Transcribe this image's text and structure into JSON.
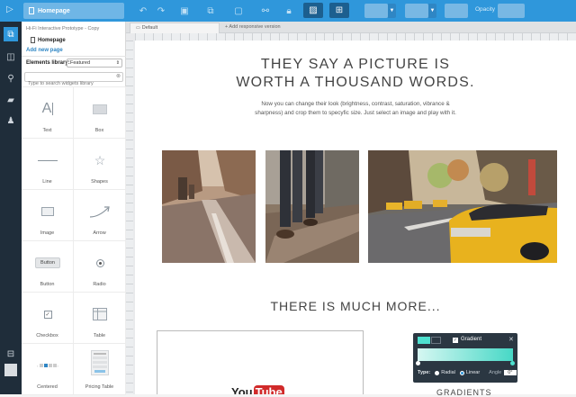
{
  "toolbar": {
    "page_name": "Homepage",
    "opacity_label": "Opacity",
    "accent": "#2f97db"
  },
  "left_icons": [
    "run-icon",
    "pages-icon",
    "layers-icon",
    "search-icon",
    "comments-icon",
    "users-icon",
    "export-icon",
    "avatar"
  ],
  "panel": {
    "project_name": "Hi-Fi Interactive Prototype - Copy",
    "page_item": "Homepage",
    "add_page": "Add new page",
    "library_label": "Elements library:",
    "library_value": "Featured",
    "search_placeholder": "Type to search widgets library",
    "widgets": [
      {
        "label": "Text",
        "icon": "text-icon"
      },
      {
        "label": "Box",
        "icon": "box-icon"
      },
      {
        "label": "Line",
        "icon": "line-icon"
      },
      {
        "label": "Shapes",
        "icon": "star-icon"
      },
      {
        "label": "Image",
        "icon": "image-icon"
      },
      {
        "label": "Arrow",
        "icon": "arrow-icon"
      },
      {
        "label": "Button",
        "icon": "button-icon",
        "icon_text": "Button"
      },
      {
        "label": "Radio",
        "icon": "radio-icon"
      },
      {
        "label": "Checkbox",
        "icon": "checkbox-icon"
      },
      {
        "label": "Table",
        "icon": "table-icon"
      },
      {
        "label": "Centered",
        "icon": "pagination-icon"
      },
      {
        "label": "Pricing Table",
        "icon": "pricing-table-icon"
      }
    ]
  },
  "canvas": {
    "tab_default": "Default",
    "tab_add": "+ Add responsive version",
    "headline_line1": "THEY SAY A PICTURE IS",
    "headline_line2": "WORTH A THOUSAND WORDS.",
    "body_line1": "Now you can change their look (brightness, contrast, saturation, vibrance &",
    "body_line2": "sharpness) and crop them to specyfic size. Just select an image and play with it.",
    "section2": "THERE IS MUCH MORE...",
    "youtube_you": "You",
    "youtube_tube": "Tube"
  },
  "gradient_popup": {
    "title": "Gradient",
    "type_label": "Type:",
    "radial": "Radial",
    "linear": "Linear",
    "angle": "Angle",
    "angle_value": "0°",
    "caption": "GRADIENTS"
  }
}
